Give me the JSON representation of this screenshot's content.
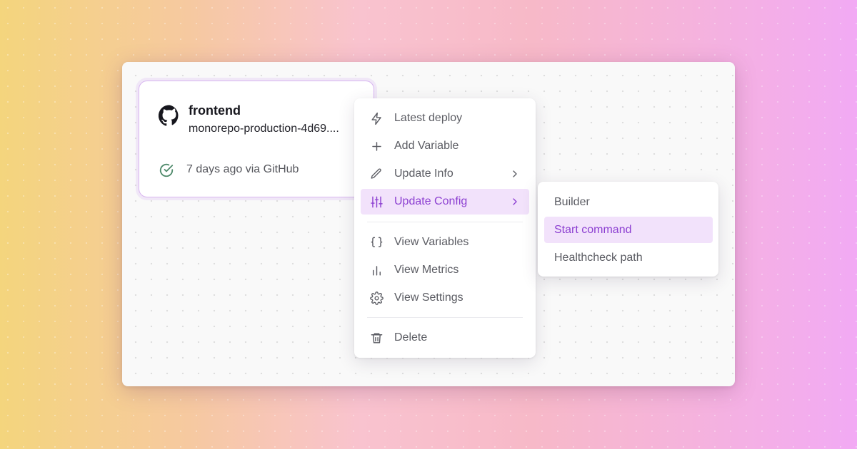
{
  "service_card": {
    "title": "frontend",
    "subtitle": "monorepo-production-4d69....",
    "deploy_status": "7 days ago via GitHub",
    "icons": {
      "source": "github-icon",
      "status": "check-circle-icon"
    }
  },
  "context_menu": {
    "latest_deploy": "Latest deploy",
    "add_variable": "Add Variable",
    "update_info": "Update Info",
    "update_config": "Update Config",
    "view_variables": "View Variables",
    "view_metrics": "View Metrics",
    "view_settings": "View Settings",
    "delete": "Delete",
    "active_item": "Update Config"
  },
  "submenu": {
    "builder": "Builder",
    "start_command": "Start command",
    "healthcheck_path": "Healthcheck path",
    "active_item": "Start command"
  },
  "colors": {
    "accent": "#8c3fd1",
    "accent_bg": "#f2e2fb",
    "success": "#4f8a6b",
    "text_muted": "#5a5b62"
  }
}
